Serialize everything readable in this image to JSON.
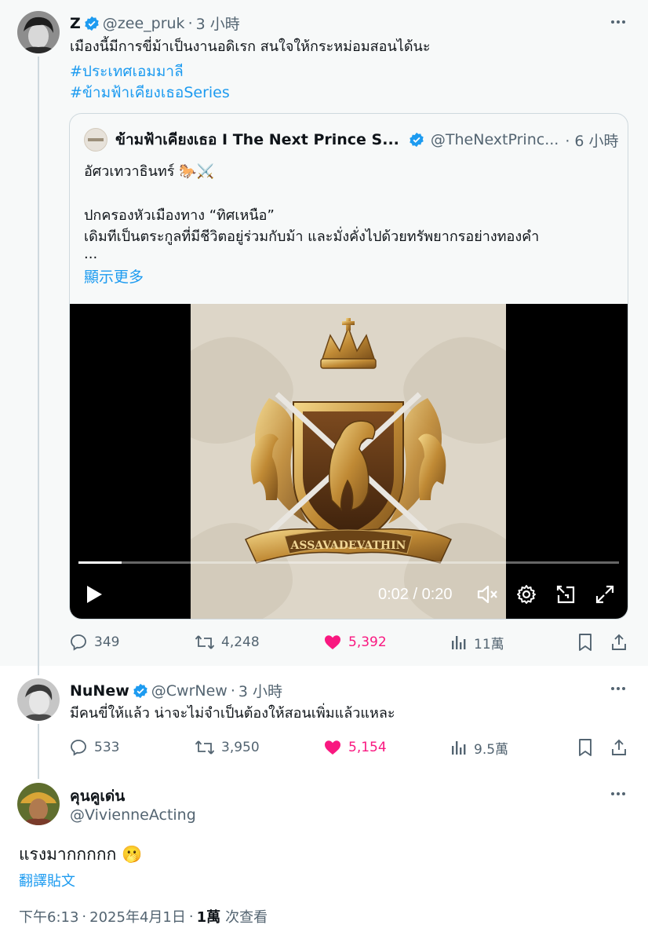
{
  "colors": {
    "link": "#1d9bf0",
    "like": "#f91880",
    "muted": "#536471",
    "verified": "#1d9bf0"
  },
  "tweet1": {
    "name": "Z",
    "handle": "@zee_pruk",
    "separator": "·",
    "time": "3 小時",
    "text": "เมืองนี้มีการขี่ม้าเป็นงานอดิเรก สนใจให้กระหม่อมสอนได้นะ",
    "hashtags": [
      "#ประเทศเอมมาลี",
      "#ข้ามฟ้าเคียงเธอSeries"
    ],
    "quote": {
      "name": "ข้ามฟ้าเคียงเธอ I The Next Prince S...",
      "handle": "@TheNextPrinc...",
      "time": "· 6 小時",
      "line1": "อัศวเทวาธินทร์ 🐎⚔️",
      "line2": "ปกครองหัวเมืองทาง “ทิศเหนือ”",
      "line3": "เดิมทีเป็นตระกูลที่มีชีวิตอยู่ร่วมกับม้า และมั่งคั่งไปด้วยทรัพยากรอย่างทองคำ",
      "line4": "...",
      "show_more": "顯示更多",
      "video": {
        "current": "0:02",
        "total": "0:20",
        "time_label": "0:02 / 0:20",
        "progress": 0.08,
        "banner_text": "ASSAVADEVATHIN"
      }
    },
    "stats": {
      "replies": "349",
      "retweets": "4,248",
      "likes": "5,392",
      "views": "11萬"
    }
  },
  "tweet2": {
    "name": "NuNew",
    "handle": "@CwrNew",
    "separator": "·",
    "time": "3 小時",
    "text": "มีคนขี่ให้แล้ว น่าจะไม่จำเป็นต้องให้สอนเพิ่มแล้วแหละ",
    "stats": {
      "replies": "533",
      "retweets": "3,950",
      "likes": "5,154",
      "views": "9.5萬"
    }
  },
  "tweet3": {
    "name": "คุนคูเด่น",
    "handle": "@VivienneActing",
    "text": "แรงมากกกกก 🫢",
    "translate": "翻譯貼文",
    "time": "下午6:13",
    "separator": "·",
    "date": "2025年4月1日",
    "views_count": "1萬",
    "views_label": "次查看"
  }
}
